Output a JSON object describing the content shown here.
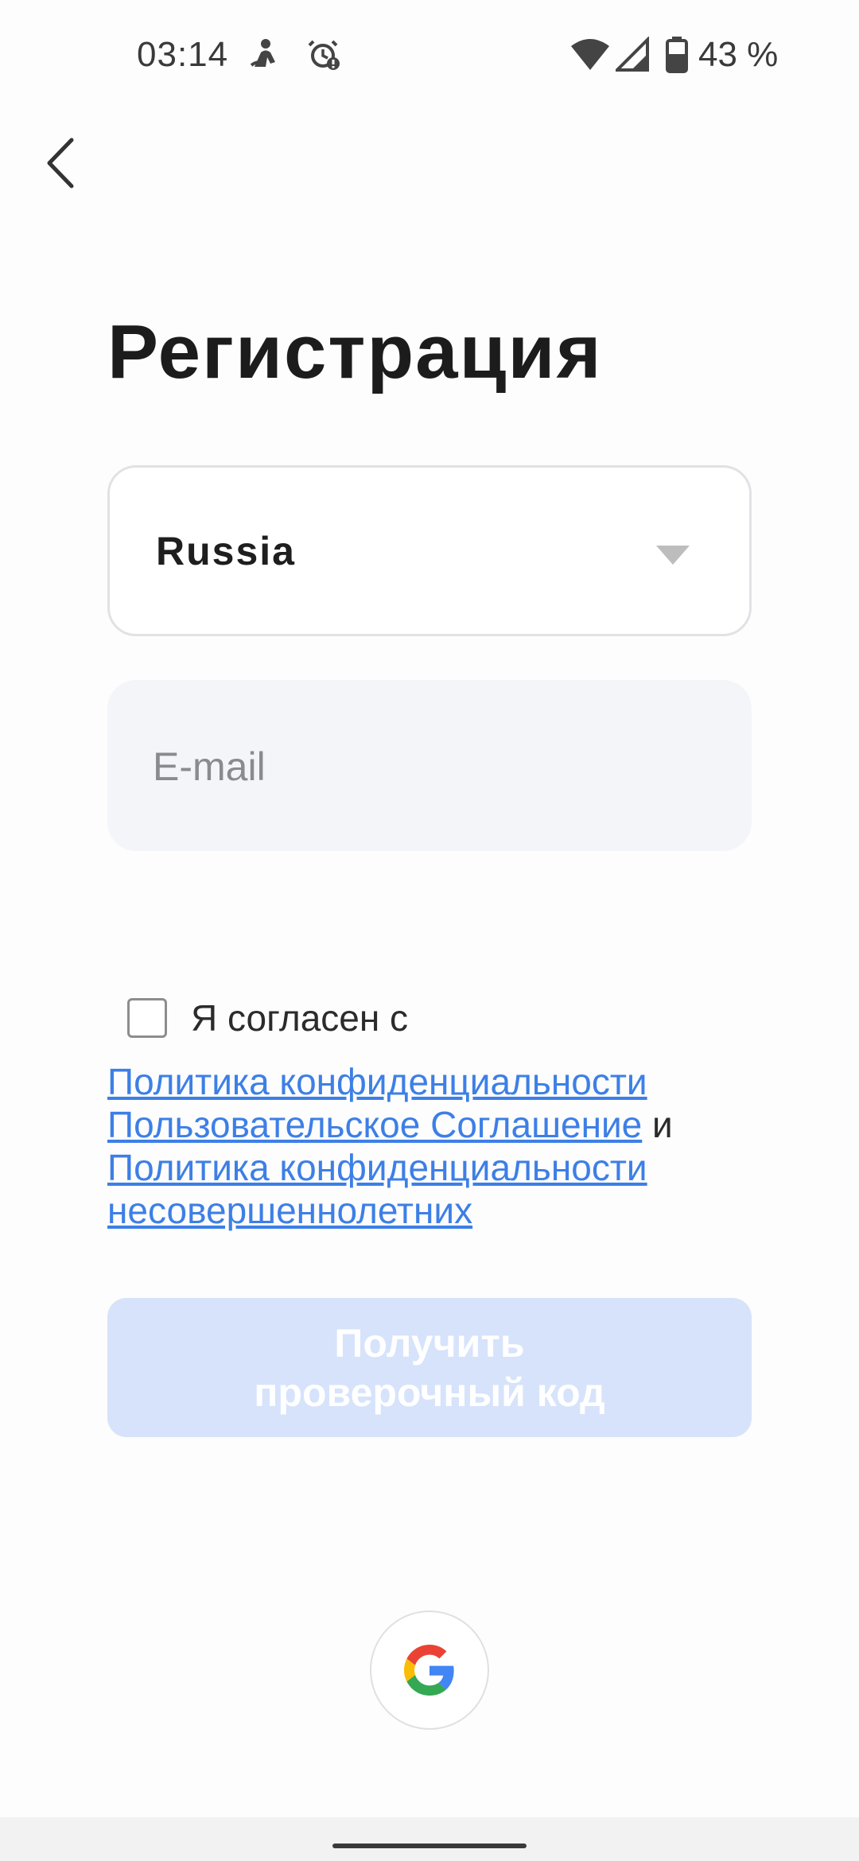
{
  "status_bar": {
    "time": "03:14",
    "battery_text": "43 %",
    "icons": [
      "app-notification-icon",
      "alarm-clock-icon",
      "wifi-icon",
      "cellular-signal-icon",
      "battery-icon"
    ]
  },
  "header": {
    "back_icon": "chevron-left-icon",
    "title": "Регистрация"
  },
  "form": {
    "country": {
      "value": "Russia",
      "icon": "dropdown-triangle-icon"
    },
    "email": {
      "placeholder": "E-mail",
      "value": ""
    },
    "agreement": {
      "checked": false,
      "label": "Я согласен с",
      "privacy_policy": "Политика конфиденциальности",
      "user_agreement": "Пользовательское Соглашение",
      "conjunction": " и ",
      "minors_privacy_policy": "Политика конфиденциальности несовершеннолетних"
    },
    "submit_label": "Получить проверочный код"
  },
  "social": {
    "google_icon": "google-logo-icon"
  },
  "colors": {
    "link": "#3d7fe6",
    "button_disabled": "#d6e3fb",
    "field_bg": "#f4f5f9"
  }
}
